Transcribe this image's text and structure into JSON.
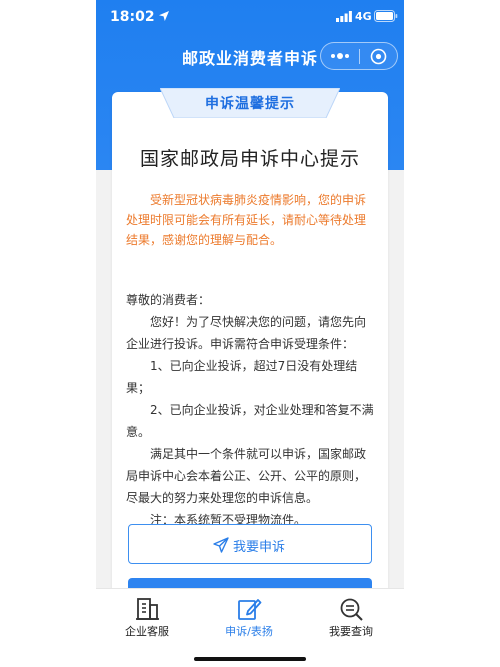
{
  "status_bar": {
    "time": "18:02",
    "network": "4G"
  },
  "nav": {
    "title": "邮政业消费者申诉"
  },
  "card": {
    "ribbon": "申诉温馨提示",
    "title": "国家邮政局申诉中心提示",
    "notice": "受新型冠状病毒肺炎疫情影响，您的申诉处理时限可能会有所有延长，请耐心等待处理结果，感谢您的理解与配合。",
    "greeting": "尊敬的消费者：",
    "paragraphs": [
      "您好！为了尽快解决您的问题，请您先向企业进行投诉。申诉需符合申诉受理条件：",
      "1、已向企业投诉，超过7日没有处理结果；",
      "2、已向企业投诉，对企业处理和答复不满意。",
      "满足其中一个条件就可以申诉，国家邮政局申诉中心会本着公正、公开、公平的原则，尽最大的努力来处理您的申诉信息。",
      "注：本系统暂不受理物流件。"
    ],
    "complain_button": "我要申诉"
  },
  "tabs": [
    {
      "label": "企业客服",
      "icon": "building-icon",
      "active": false
    },
    {
      "label": "申诉/表扬",
      "icon": "edit-icon",
      "active": true
    },
    {
      "label": "我要查询",
      "icon": "search-list-icon",
      "active": false
    }
  ],
  "colors": {
    "primary": "#2a7ee8",
    "notice": "#ec7a2c",
    "header": "#1f7ff0"
  }
}
